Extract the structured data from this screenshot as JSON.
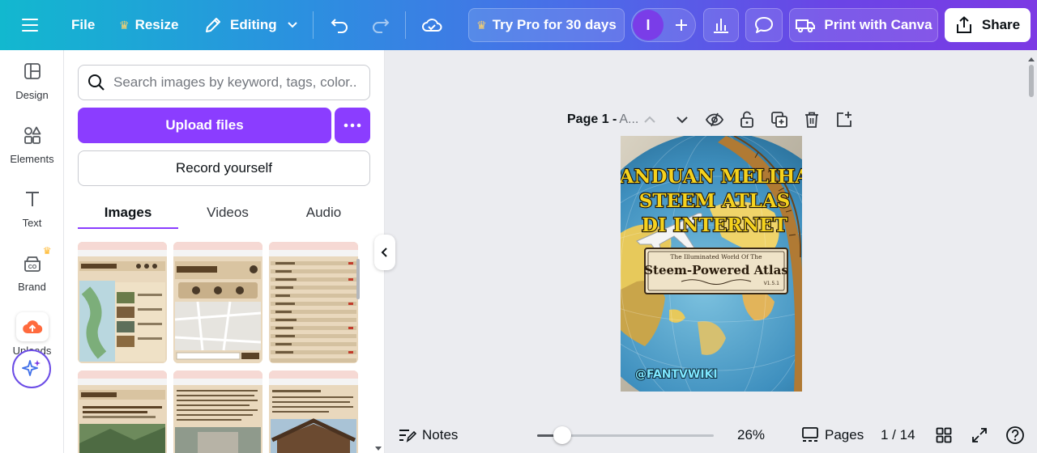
{
  "toolbar": {
    "file_label": "File",
    "resize_label": "Resize",
    "editing_label": "Editing",
    "try_pro_label": "Try Pro for 30 days",
    "avatar_initial": "I",
    "print_label": "Print with Canva",
    "share_label": "Share"
  },
  "rail": {
    "items": [
      {
        "label": "Design",
        "icon": "layout-icon"
      },
      {
        "label": "Elements",
        "icon": "shapes-icon"
      },
      {
        "label": "Text",
        "icon": "text-icon"
      },
      {
        "label": "Brand",
        "icon": "brand-icon"
      },
      {
        "label": "Uploads",
        "icon": "cloud-upload-icon"
      }
    ],
    "active": "Uploads"
  },
  "panel": {
    "search_placeholder": "Search images by keyword, tags, color...",
    "upload_label": "Upload files",
    "record_label": "Record yourself",
    "tabs": [
      {
        "label": "Images"
      },
      {
        "label": "Videos"
      },
      {
        "label": "Audio"
      }
    ],
    "active_tab": "Images"
  },
  "canvas": {
    "page_title": "Page 1 - ",
    "page_name": "A...",
    "design": {
      "headline_lines": [
        "PANDUAN MELIHAT",
        "STEEM ATLAS",
        "DI INTERNET"
      ],
      "banner_small": "The Illuminated World Of The",
      "banner_title": "Steem-Powered Atlas",
      "version": "V1.5.1",
      "handle": "@FANTVWIKI"
    }
  },
  "bottombar": {
    "notes_label": "Notes",
    "zoom_percent": 26,
    "zoom_label": "26%",
    "pages_label": "Pages",
    "page_counter": "1 / 14"
  },
  "colors": {
    "accent": "#8b3dff",
    "gradient_start": "#12b8cf",
    "gradient_end": "#7c3ae4"
  }
}
